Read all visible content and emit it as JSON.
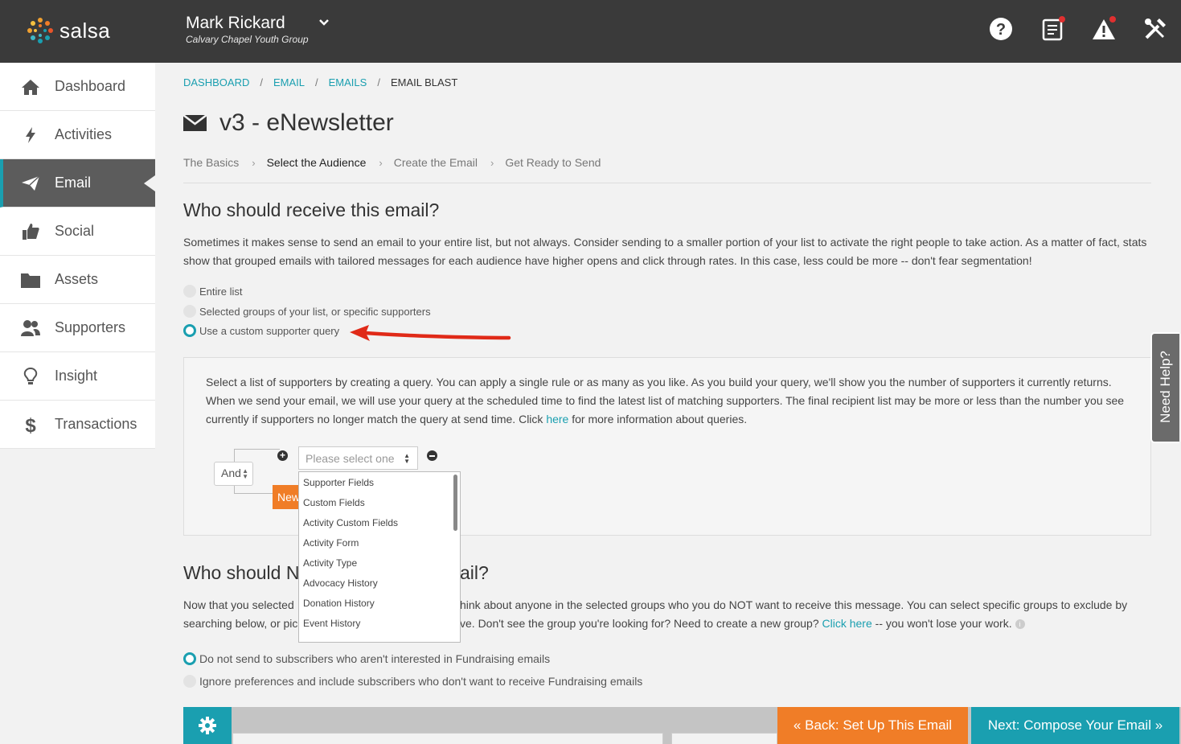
{
  "brand": {
    "logo_text": "salsa",
    "accent": "#1a9fb0",
    "orange": "#f07d27"
  },
  "header": {
    "user_name": "Mark Rickard",
    "org_name": "Calvary Chapel Youth Group",
    "icons": [
      "help-icon",
      "notes-icon",
      "alert-icon",
      "tools-icon"
    ]
  },
  "sidebar": {
    "items": [
      {
        "label": "Dashboard",
        "icon": "home-icon"
      },
      {
        "label": "Activities",
        "icon": "lightning-icon"
      },
      {
        "label": "Email",
        "icon": "paper-plane-icon",
        "active": true
      },
      {
        "label": "Social",
        "icon": "thumbs-up-icon"
      },
      {
        "label": "Assets",
        "icon": "folder-icon"
      },
      {
        "label": "Supporters",
        "icon": "users-icon"
      },
      {
        "label": "Insight",
        "icon": "lightbulb-icon"
      },
      {
        "label": "Transactions",
        "icon": "dollar-icon"
      }
    ]
  },
  "breadcrumb": {
    "items": [
      "DASHBOARD",
      "EMAIL",
      "EMAILS"
    ],
    "current": "EMAIL BLAST"
  },
  "page_title": "v3 - eNewsletter",
  "steps": [
    "The Basics",
    "Select the Audience",
    "Create the Email",
    "Get Ready to Send"
  ],
  "audience": {
    "heading": "Who should receive this email?",
    "description": "Sometimes it makes sense to send an email to your entire list, but not always. Consider sending to a smaller portion of your list to activate the right people to take action. As a matter of fact, stats show that grouped emails with tailored messages for each audience have higher opens and click through rates. In this case, less could be more -- don't fear segmentation!",
    "options": [
      "Entire list",
      "Selected groups of your list, or specific supporters",
      "Use a custom supporter query"
    ],
    "selected_index": 2
  },
  "query": {
    "description_before": "Select a list of supporters by creating a query. You can apply a single rule or as many as you like. As you build your query, we'll show you the number of supporters it currently returns. When we send your email, we will use your query at the scheduled time to find the latest list of matching supporters. The final recipient list may be more or less than the number you see currently if supporters no longer match the query at send time. Click ",
    "link": "here",
    "description_after": " for more information about queries.",
    "operator": "And",
    "new_button": "New",
    "select_placeholder": "Please select one",
    "dropdown_options": [
      "Supporter Fields",
      "Custom Fields",
      "Activity Custom Fields",
      "Activity Form",
      "Activity Type",
      "Advocacy History",
      "Donation History",
      "Event History"
    ]
  },
  "exclude": {
    "heading_left": "Who should N",
    "heading_right": "ail?",
    "line1_left": "Now that you selected",
    "line1_right": "hink about anyone in the selected groups who you do NOT want to receive this message. You can select specific groups to exclude by",
    "line2_left": "searching below, or pic",
    "line2_right": "ve. Don't see the group you're looking for? Need to create a new group? ",
    "line2_link": "Click here",
    "line2_after": " -- you won't lose your work.",
    "options": [
      "Do not send to subscribers who aren't interested in Fundraising emails",
      "Ignore preferences and include subscribers who don't want to receive Fundraising emails"
    ],
    "selected_index": 0
  },
  "footer": {
    "back_label": "« Back: Set Up This Email",
    "next_label": "Next: Compose Your Email »"
  },
  "need_help": "Need Help?"
}
